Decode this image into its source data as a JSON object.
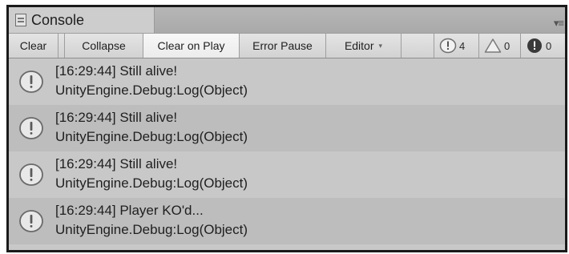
{
  "window": {
    "tab_title": "Console",
    "tab_icon": "console-icon",
    "menu_icon": "panel-menu-icon"
  },
  "toolbar": {
    "clear_label": "Clear",
    "collapse_label": "Collapse",
    "clear_on_play_label": "Clear on Play",
    "error_pause_label": "Error Pause",
    "editor_label": "Editor"
  },
  "counters": {
    "info_count": "4",
    "warning_count": "0",
    "error_count": "0"
  },
  "logs": [
    {
      "line1": "[16:29:44] Still alive!",
      "line2": "UnityEngine.Debug:Log(Object)",
      "icon": "info-icon"
    },
    {
      "line1": "[16:29:44] Still alive!",
      "line2": "UnityEngine.Debug:Log(Object)",
      "icon": "info-icon"
    },
    {
      "line1": "[16:29:44] Still alive!",
      "line2": "UnityEngine.Debug:Log(Object)",
      "icon": "info-icon"
    },
    {
      "line1": "[16:29:44] Player KO'd...",
      "line2": "UnityEngine.Debug:Log(Object)",
      "icon": "info-icon"
    }
  ]
}
